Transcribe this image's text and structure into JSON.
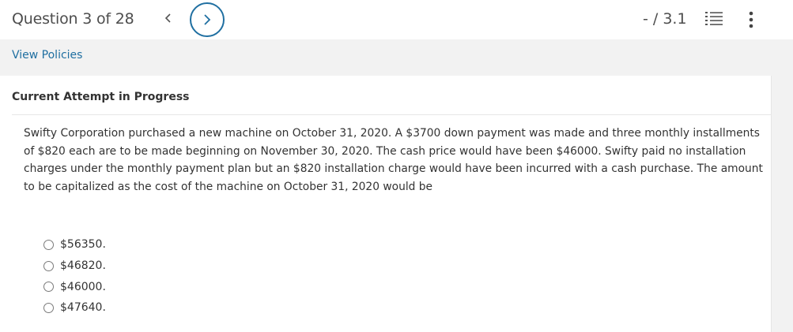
{
  "header": {
    "question_counter": "Question 3 of 28",
    "prev_icon": "chevron-left-icon",
    "next_icon": "chevron-right-icon",
    "score": "- / 3.1",
    "list_icon": "numbered-list-icon",
    "more_icon": "vertical-ellipsis-icon"
  },
  "links": {
    "view_policies": "View Policies"
  },
  "attempt": {
    "heading": "Current Attempt in Progress"
  },
  "question": {
    "text": "Swifty Corporation purchased a new machine on October 31, 2020. A $3700 down payment was made and three monthly installments of $820 each are to be made beginning on November 30, 2020. The cash price would have been $46000. Swifty paid no installation charges under the monthly payment plan but an $820 installation charge would have been incurred with a cash purchase. The amount to be capitalized as the cost of the machine on October 31, 2020 would be",
    "options": [
      {
        "label": "$56350.",
        "selected": false
      },
      {
        "label": "$46820.",
        "selected": false
      },
      {
        "label": "$46000.",
        "selected": false
      },
      {
        "label": "$47640.",
        "selected": false
      }
    ]
  },
  "colors": {
    "accent": "#1f6fa1",
    "text": "#333333"
  }
}
